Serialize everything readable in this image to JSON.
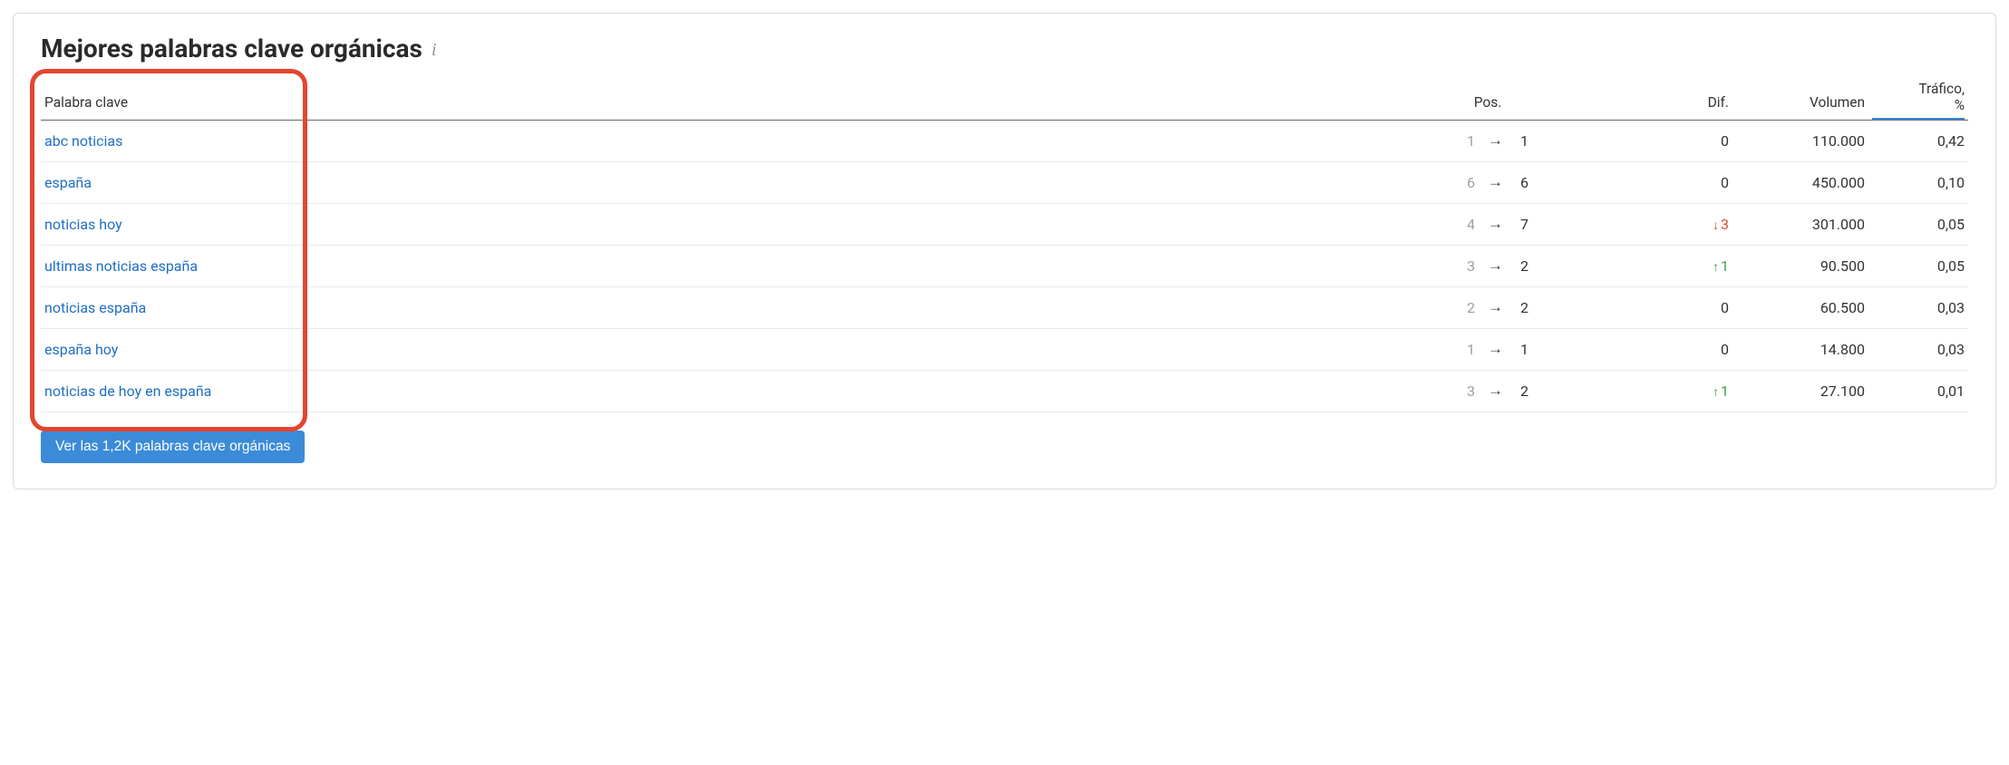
{
  "title": "Mejores palabras clave orgánicas",
  "headers": {
    "keyword": "Palabra clave",
    "pos": "Pos.",
    "dif": "Dif.",
    "volume": "Volumen",
    "traffic_line1": "Tráfico,",
    "traffic_line2": "%"
  },
  "rows": [
    {
      "keyword": "abc noticias",
      "pos_prev": "1",
      "pos_curr": "1",
      "dif_dir": "",
      "dif_val": "0",
      "volume": "110.000",
      "traffic": "0,42"
    },
    {
      "keyword": "españa",
      "pos_prev": "6",
      "pos_curr": "6",
      "dif_dir": "",
      "dif_val": "0",
      "volume": "450.000",
      "traffic": "0,10"
    },
    {
      "keyword": "noticias hoy",
      "pos_prev": "4",
      "pos_curr": "7",
      "dif_dir": "down",
      "dif_val": "3",
      "volume": "301.000",
      "traffic": "0,05"
    },
    {
      "keyword": "ultimas noticias españa",
      "pos_prev": "3",
      "pos_curr": "2",
      "dif_dir": "up",
      "dif_val": "1",
      "volume": "90.500",
      "traffic": "0,05"
    },
    {
      "keyword": "noticias españa",
      "pos_prev": "2",
      "pos_curr": "2",
      "dif_dir": "",
      "dif_val": "0",
      "volume": "60.500",
      "traffic": "0,03"
    },
    {
      "keyword": "españa hoy",
      "pos_prev": "1",
      "pos_curr": "1",
      "dif_dir": "",
      "dif_val": "0",
      "volume": "14.800",
      "traffic": "0,03"
    },
    {
      "keyword": "noticias de hoy en españa",
      "pos_prev": "3",
      "pos_curr": "2",
      "dif_dir": "up",
      "dif_val": "1",
      "volume": "27.100",
      "traffic": "0,01"
    }
  ],
  "button_label": "Ver las 1,2K palabras clave orgánicas"
}
